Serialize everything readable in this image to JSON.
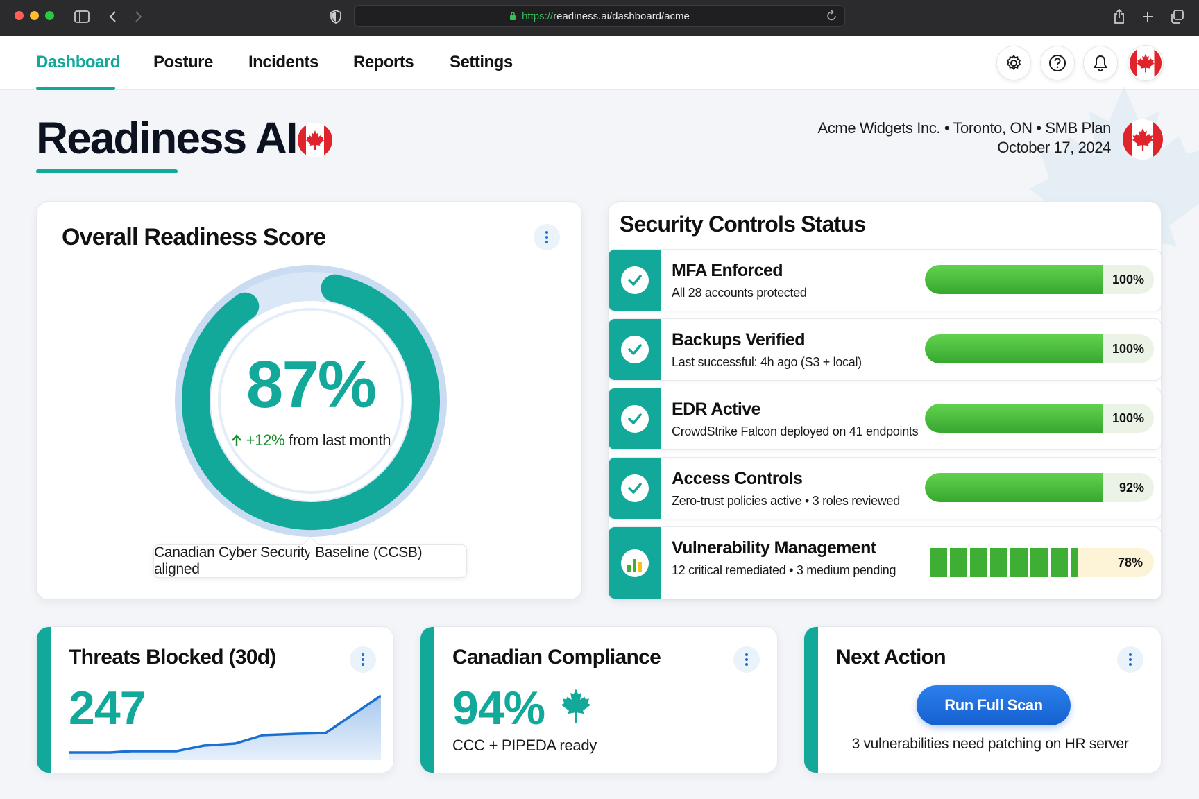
{
  "browser": {
    "url_scheme": "https://",
    "url_rest": "readiness.ai/dashboard/acme"
  },
  "nav": {
    "tabs": [
      {
        "label": "Dashboard",
        "active": true
      },
      {
        "label": "Posture",
        "active": false
      },
      {
        "label": "Incidents",
        "active": false
      },
      {
        "label": "Reports",
        "active": false
      },
      {
        "label": "Settings",
        "active": false
      }
    ],
    "icons": [
      "gear-icon",
      "help-icon",
      "bell-icon",
      "canada-flag-icon"
    ]
  },
  "header": {
    "title": "Readiness AI",
    "org": "Acme Widgets Inc. • Toronto, ON • SMB Plan",
    "date": "October 17, 2024"
  },
  "score": {
    "title": "Overall Readiness Score",
    "value": "87%",
    "fraction": 0.87,
    "delta": "+12%",
    "delta_suffix": " from last month",
    "baseline": "Canadian Cyber Security Baseline (CCSB) aligned"
  },
  "controls": {
    "title": "Security Controls Status",
    "items": [
      {
        "name": "MFA Enforced",
        "desc": "All 28 accounts protected",
        "pct": "100%",
        "icon": "check-icon"
      },
      {
        "name": "Backups Verified",
        "desc": "Last successful: 4h ago (S3 + local)",
        "pct": "100%",
        "icon": "check-icon"
      },
      {
        "name": "EDR Active",
        "desc": "CrowdStrike Falcon deployed on 41 endpoints",
        "pct": "100%",
        "icon": "check-icon"
      },
      {
        "name": "Access Controls",
        "desc": "Zero-trust policies active • 3 roles reviewed",
        "pct": "92%",
        "icon": "check-icon"
      },
      {
        "name": "Vulnerability Management",
        "desc": "12 critical remediated • 3 medium pending",
        "pct": "78%",
        "icon": "bar-chart-icon"
      }
    ]
  },
  "threats": {
    "title": "Threats Blocked (30d)",
    "value": "247"
  },
  "compliance": {
    "title": "Canadian Compliance",
    "value": "94%",
    "sub": "CCC + PIPEDA ready"
  },
  "next_action": {
    "title": "Next Action",
    "button": "Run Full Scan",
    "note": "3 vulnerabilities need patching on HR server"
  },
  "colors": {
    "accent": "#12a89a",
    "progress_green": "#3fae35",
    "warning": "#f5c21b",
    "button_blue": "#1c6fd1",
    "canada_red": "#e0242b"
  }
}
